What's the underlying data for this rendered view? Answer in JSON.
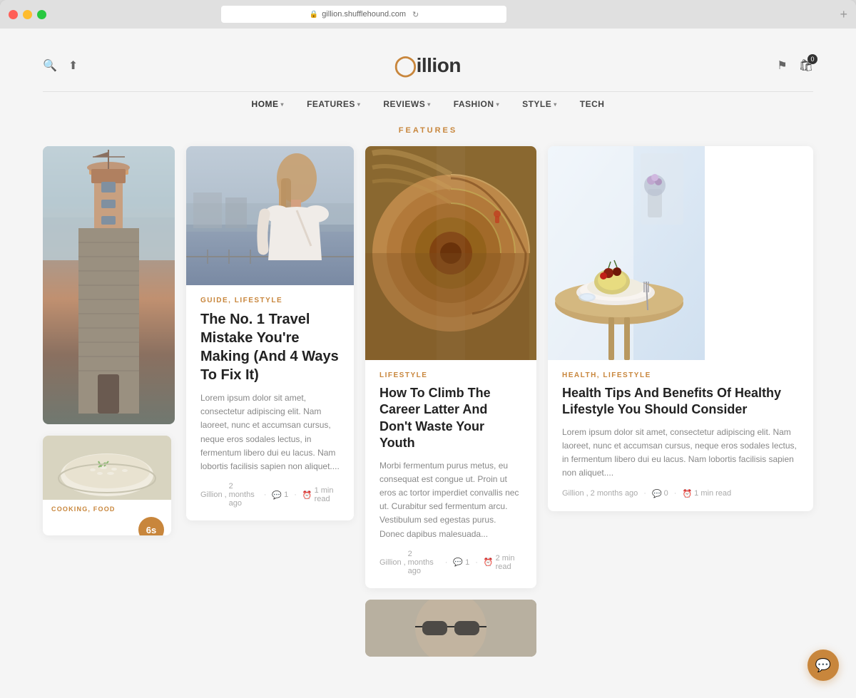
{
  "browser": {
    "url": "gillion.shufflehound.com",
    "reload_icon": "↻",
    "plus_icon": "+"
  },
  "logo": {
    "prefix": "G",
    "suffix": "illion"
  },
  "header": {
    "search_icon": "🔍",
    "share_icon": "⬆",
    "notification_icon": "🔔",
    "cart_count": "0"
  },
  "nav": {
    "items": [
      {
        "label": "HOME",
        "has_arrow": true
      },
      {
        "label": "FEATURES",
        "has_arrow": true
      },
      {
        "label": "REVIEWS",
        "has_arrow": true
      },
      {
        "label": "FASHION",
        "has_arrow": true
      },
      {
        "label": "STYLE",
        "has_arrow": true
      },
      {
        "label": "TECH",
        "has_arrow": false
      }
    ]
  },
  "features_label": "FeaTuRES",
  "articles": [
    {
      "id": "travel",
      "category": "GUIDE, LIFESTYLE",
      "title": "The No. 1 Travel Mistake You're Making (And 4 Ways To Fix It)",
      "excerpt": "Lorem ipsum dolor sit amet, consectetur adipiscing elit. Nam laoreet, nunc et accumsan cursus, neque eros sodales lectus, in fermentum libero dui eu lacus. Nam lobortis facilisis sapien non aliquet....",
      "author": "Gillion",
      "time_ago": "2 months ago",
      "comments": "1",
      "read_time": "1 min read"
    },
    {
      "id": "climb",
      "category": "LIFESTYLE",
      "title": "How To Climb The Career Latter And Don't Waste Your Youth",
      "excerpt": "Morbi fermentum purus metus, eu consequat est congue ut. Proin ut eros ac tortor imperdiet convallis nec ut. Curabitur sed fermentum arcu. Vestibulum sed egestas purus. Donec dapibus malesuada...",
      "author": "Gillion",
      "time_ago": "2 months ago",
      "comments": "1",
      "read_time": "2 min read"
    },
    {
      "id": "health",
      "category": "HEALTH, LIFESTYLE",
      "title": "Health Tips And Benefits Of Healthy Lifestyle You Should Consider",
      "excerpt": "Lorem ipsum dolor sit amet, consectetur adipiscing elit. Nam laoreet, nunc et accumsan cursus, neque eros sodales lectus, in fermentum libero dui eu lacus. Nam lobortis facilisis sapien non aliquet....",
      "author": "Gillion",
      "time_ago": "2 months ago",
      "comments": "0",
      "read_time": "1 min read"
    }
  ],
  "bottom_cards": [
    {
      "id": "cooking",
      "category": "COOKING, FOOD"
    }
  ],
  "carousel_slide": "6s",
  "chat_icon": "💬"
}
